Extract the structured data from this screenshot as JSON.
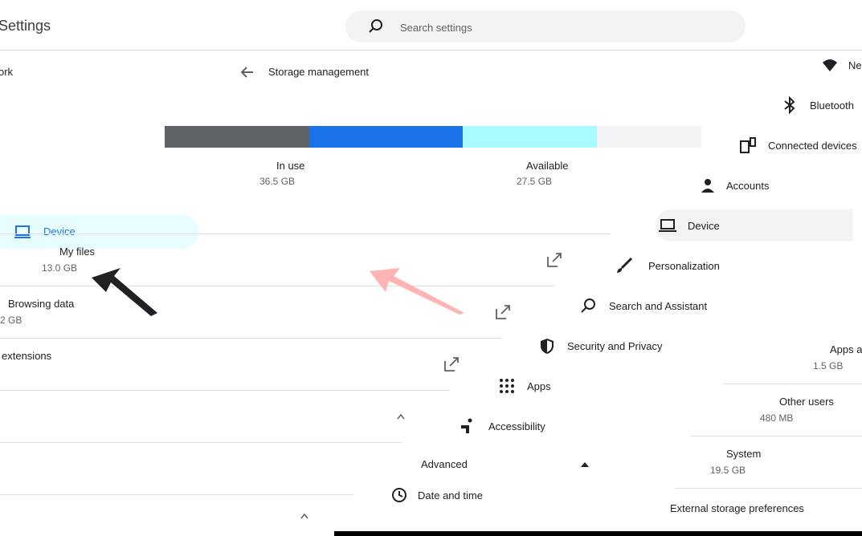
{
  "header": {
    "app_title": "Settings",
    "search_placeholder": "Search settings"
  },
  "left_nav": {
    "network_partial": "ork",
    "device_label": "Device"
  },
  "storage": {
    "title": "Storage management",
    "bar_segments": [
      {
        "name": "system",
        "color": "#5f6368",
        "fraction": 0.27
      },
      {
        "name": "in-use",
        "color": "#1a73e8",
        "fraction": 0.285
      },
      {
        "name": "other",
        "color": "#a8fcff",
        "fraction": 0.25
      },
      {
        "name": "available",
        "color": "#f1f3f4",
        "fraction": 0.195
      }
    ],
    "in_use_label": "In use",
    "in_use_value": "36.5 GB",
    "available_label": "Available",
    "available_value": "27.5 GB"
  },
  "rows": {
    "my_files": {
      "title": "My files",
      "size": "13.0 GB"
    },
    "browsing_data": {
      "title": "Browsing data",
      "size": "2 GB"
    },
    "extensions": {
      "title": "extensions"
    },
    "apps": {
      "title": "Apps a",
      "size": "1.5 GB"
    },
    "other_users": {
      "title": "Other users",
      "size": "480 MB"
    },
    "system": {
      "title": "System",
      "size": "19.5 GB"
    },
    "external": {
      "title": "External storage preferences"
    }
  },
  "nav": {
    "items": [
      {
        "label": "Ne",
        "icon": "wifi-icon"
      },
      {
        "label": "Bluetooth",
        "icon": "bluetooth-icon"
      },
      {
        "label": "Connected devices",
        "icon": "connected-devices-icon"
      },
      {
        "label": "Accounts",
        "icon": "account-icon"
      },
      {
        "label": "Device",
        "icon": "laptop-icon"
      },
      {
        "label": "Personalization",
        "icon": "brush-icon"
      },
      {
        "label": "Search and Assistant",
        "icon": "search-assistant-icon"
      },
      {
        "label": "Security and Privacy",
        "icon": "shield-icon"
      },
      {
        "label": "Apps",
        "icon": "apps-grid-icon"
      },
      {
        "label": "Accessibility",
        "icon": "accessibility-icon"
      }
    ],
    "advanced_label": "Advanced",
    "date_time_label": "Date and time"
  },
  "colors": {
    "accent": "#1a73e8",
    "arrow_black": "#202124",
    "arrow_pink": "#ffb3b3"
  }
}
